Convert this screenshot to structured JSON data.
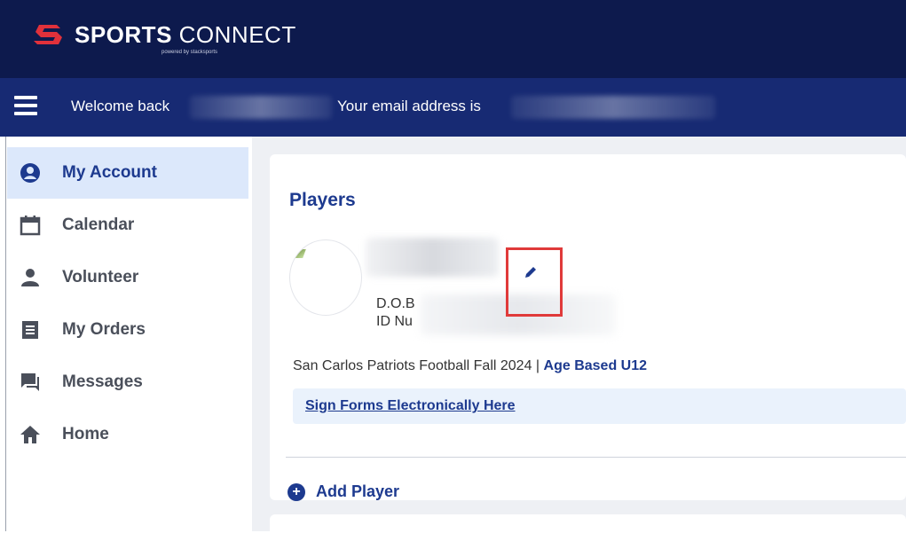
{
  "brand": {
    "logo_bold": "SPORTS",
    "logo_light": "CONNECT",
    "powered_by": "powered by stacksports",
    "accent_color": "#e0313b",
    "navy": "#0d1a4d"
  },
  "welcome": {
    "welcome_label": "Welcome back",
    "email_label": "Your email address is"
  },
  "sidebar": {
    "items": [
      {
        "label": "My Account",
        "icon": "user-circle-icon",
        "active": true
      },
      {
        "label": "Calendar",
        "icon": "calendar-icon",
        "active": false
      },
      {
        "label": "Volunteer",
        "icon": "person-icon",
        "active": false
      },
      {
        "label": "My Orders",
        "icon": "receipt-icon",
        "active": false
      },
      {
        "label": "Messages",
        "icon": "chat-icon",
        "active": false
      },
      {
        "label": "Home",
        "icon": "home-icon",
        "active": false
      }
    ]
  },
  "players": {
    "title": "Players",
    "dob_label": "D.O.B",
    "id_label": "ID Nu",
    "team_name": "San Carlos Patriots Football Fall 2024",
    "team_separator": "|",
    "division": "Age Based U12",
    "forms_link": "Sign Forms Electronically Here",
    "add_player": "Add Player"
  }
}
